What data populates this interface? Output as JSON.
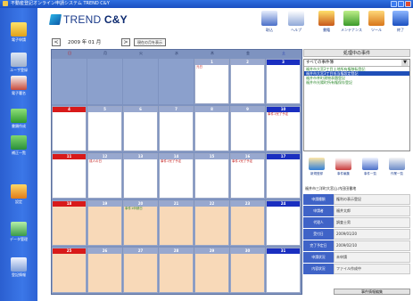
{
  "window": {
    "title": "不動産登記オンライン申請システム TREND C&Y"
  },
  "sidebar": {
    "items": [
      {
        "label": "電子申請",
        "icon": "send-icon"
      },
      {
        "label": "ユーザ登録",
        "icon": "user-icon"
      },
      {
        "label": "電子署名",
        "icon": "sign-icon"
      },
      {
        "label": "書類作成",
        "icon": "document-icon"
      },
      {
        "label": "補正一覧",
        "icon": "list-icon"
      },
      {
        "label": "設定",
        "icon": "settings-icon"
      },
      {
        "label": "データ管理",
        "icon": "database-icon"
      },
      {
        "label": "登記情報",
        "icon": "register-icon"
      }
    ]
  },
  "toolbar": {
    "logo_text": "TREND",
    "logo_bold": "C&Y",
    "buttons": [
      {
        "label": "取込",
        "icon": "import-icon"
      },
      {
        "label": "ヘルプ",
        "icon": "help-icon"
      },
      {
        "label": "書籍",
        "icon": "book-icon"
      },
      {
        "label": "メンテナンス",
        "icon": "maintenance-icon"
      },
      {
        "label": "ツール",
        "icon": "tool-icon"
      },
      {
        "label": "終了",
        "icon": "exit-icon"
      }
    ]
  },
  "nav": {
    "prev": "<",
    "next": ">",
    "month": "2009 年 01 月",
    "show_month_button": "現在の月を表示"
  },
  "calendar": {
    "weekdays": [
      "日",
      "月",
      "火",
      "水",
      "木",
      "金",
      "土"
    ],
    "weeks": [
      [
        {
          "day": ""
        },
        {
          "day": ""
        },
        {
          "day": ""
        },
        {
          "day": ""
        },
        {
          "day": "1",
          "events": [
            "元日"
          ]
        },
        {
          "day": "2"
        },
        {
          "day": "3"
        }
      ],
      [
        {
          "day": "4"
        },
        {
          "day": "5"
        },
        {
          "day": "6"
        },
        {
          "day": "7"
        },
        {
          "day": "8"
        },
        {
          "day": "9"
        },
        {
          "day": "10",
          "events": [
            "事件1完了予定"
          ]
        }
      ],
      [
        {
          "day": "11"
        },
        {
          "day": "12",
          "events": [
            "成人の日"
          ]
        },
        {
          "day": "13"
        },
        {
          "day": "14",
          "events": [
            "事件1完了予定"
          ]
        },
        {
          "day": "15"
        },
        {
          "day": "16",
          "events": [
            "事件1完了予定"
          ]
        },
        {
          "day": "17"
        }
      ],
      [
        {
          "day": "18"
        },
        {
          "day": "19"
        },
        {
          "day": "20",
          "events": [
            "事件1申請日"
          ],
          "green": true
        },
        {
          "day": "21"
        },
        {
          "day": "22"
        },
        {
          "day": "23"
        },
        {
          "day": "24"
        }
      ],
      [
        {
          "day": "25"
        },
        {
          "day": "26"
        },
        {
          "day": "27"
        },
        {
          "day": "28"
        },
        {
          "day": "29"
        },
        {
          "day": "30"
        },
        {
          "day": "31"
        }
      ]
    ]
  },
  "process": {
    "title": "処理中の事件",
    "select": "すべての事件簿",
    "items": [
      "福井市大宮2丁目土地所有権移転登記",
      "福井市大宮3丁目抵当権設定登記",
      "福井市幸町建物表題登記",
      "福井市光陽町所有権保存登記"
    ],
    "selected_index": 1
  },
  "mini_toolbar": [
    {
      "label": "新規登録",
      "icon": "new-icon"
    },
    {
      "label": "事件編集",
      "icon": "edit-icon"
    },
    {
      "label": "事件一覧",
      "icon": "list-icon"
    },
    {
      "label": "作業一覧",
      "icon": "task-icon"
    }
  ],
  "detail": {
    "title": "福井市三洋町大宮山.内田田番地",
    "rows": [
      {
        "label": "申請種類",
        "value": "権利の表示登記"
      },
      {
        "label": "申請者",
        "value": "福井太郎"
      },
      {
        "label": "代理人",
        "value": "調査士男"
      },
      {
        "label": "受付日",
        "value": "2009/01/20"
      },
      {
        "label": "完了予定日",
        "value": "2009/02/10"
      },
      {
        "label": "申請状況",
        "value": "未申請"
      },
      {
        "label": "内容状況",
        "value": "ファイル作成中"
      }
    ],
    "button": "事件情報編集"
  },
  "colors": {
    "titlebar": "#2f6fe0",
    "sidebar": "#3b77e8",
    "calendar_bg": "#7e93c0",
    "past_cell": "#f8d9b8",
    "sunday": "#d81a1a",
    "saturday": "#1a2fc0",
    "detail_label": "#3f63c7"
  }
}
